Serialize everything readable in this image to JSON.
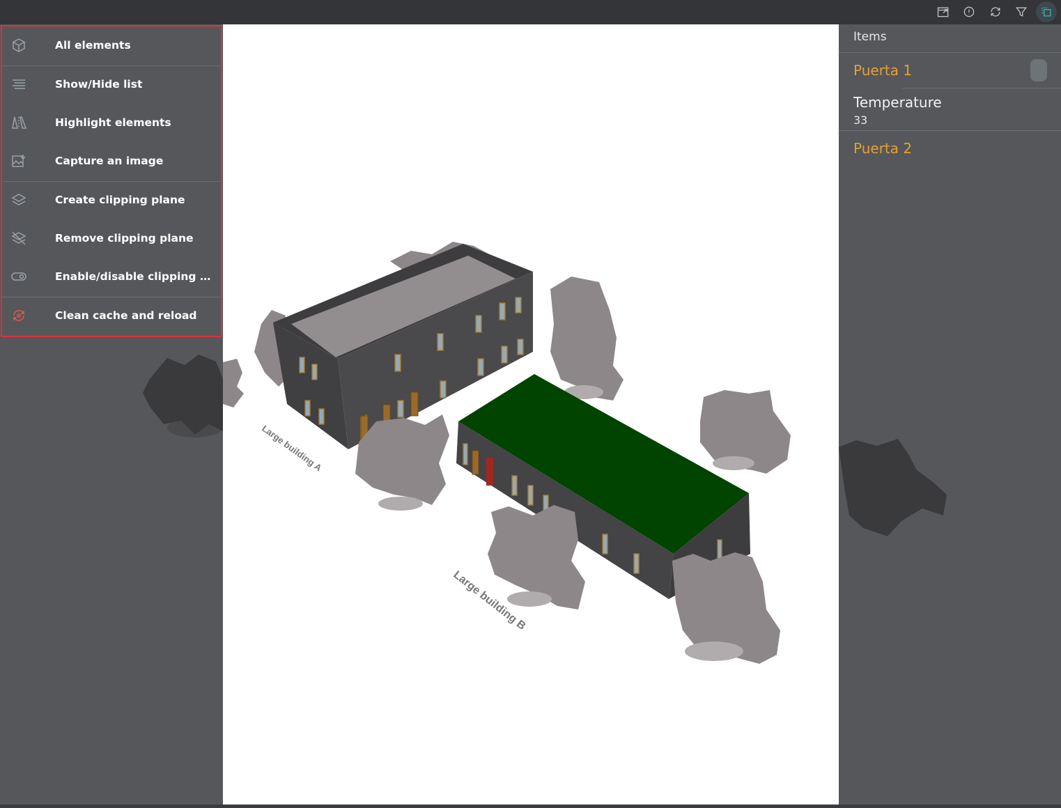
{
  "toolbar": {
    "icons": [
      "open-external-icon",
      "info-icon",
      "refresh-icon",
      "filter-icon",
      "layers-icon"
    ]
  },
  "menu": {
    "items": [
      {
        "label": "All elements",
        "icon": "cube-icon"
      },
      {
        "label": "Show/Hide list",
        "icon": "list-icon"
      },
      {
        "label": "Highlight elements",
        "icon": "highlight-icon"
      },
      {
        "label": "Capture an image",
        "icon": "capture-image-icon"
      },
      {
        "label": "Create clipping plane",
        "icon": "layers-icon"
      },
      {
        "label": "Remove clipping plane",
        "icon": "layers-off-icon"
      },
      {
        "label": "Enable/disable clipping pl...",
        "icon": "toggle-icon"
      },
      {
        "label": "Clean cache and reload",
        "icon": "reload-icon"
      }
    ]
  },
  "scene": {
    "label_a": "Large building A",
    "label_b": "Large building B",
    "roof_color": "#004400"
  },
  "items_panel": {
    "header": "Items",
    "item1": "Puerta 1",
    "item2_title": "Temperature",
    "item2_value": "33",
    "item3": "Puerta 2"
  },
  "colors": {
    "accent_orange": "#e8a02e",
    "highlight_border": "#e0303a",
    "panel_bg": "#55575a"
  }
}
